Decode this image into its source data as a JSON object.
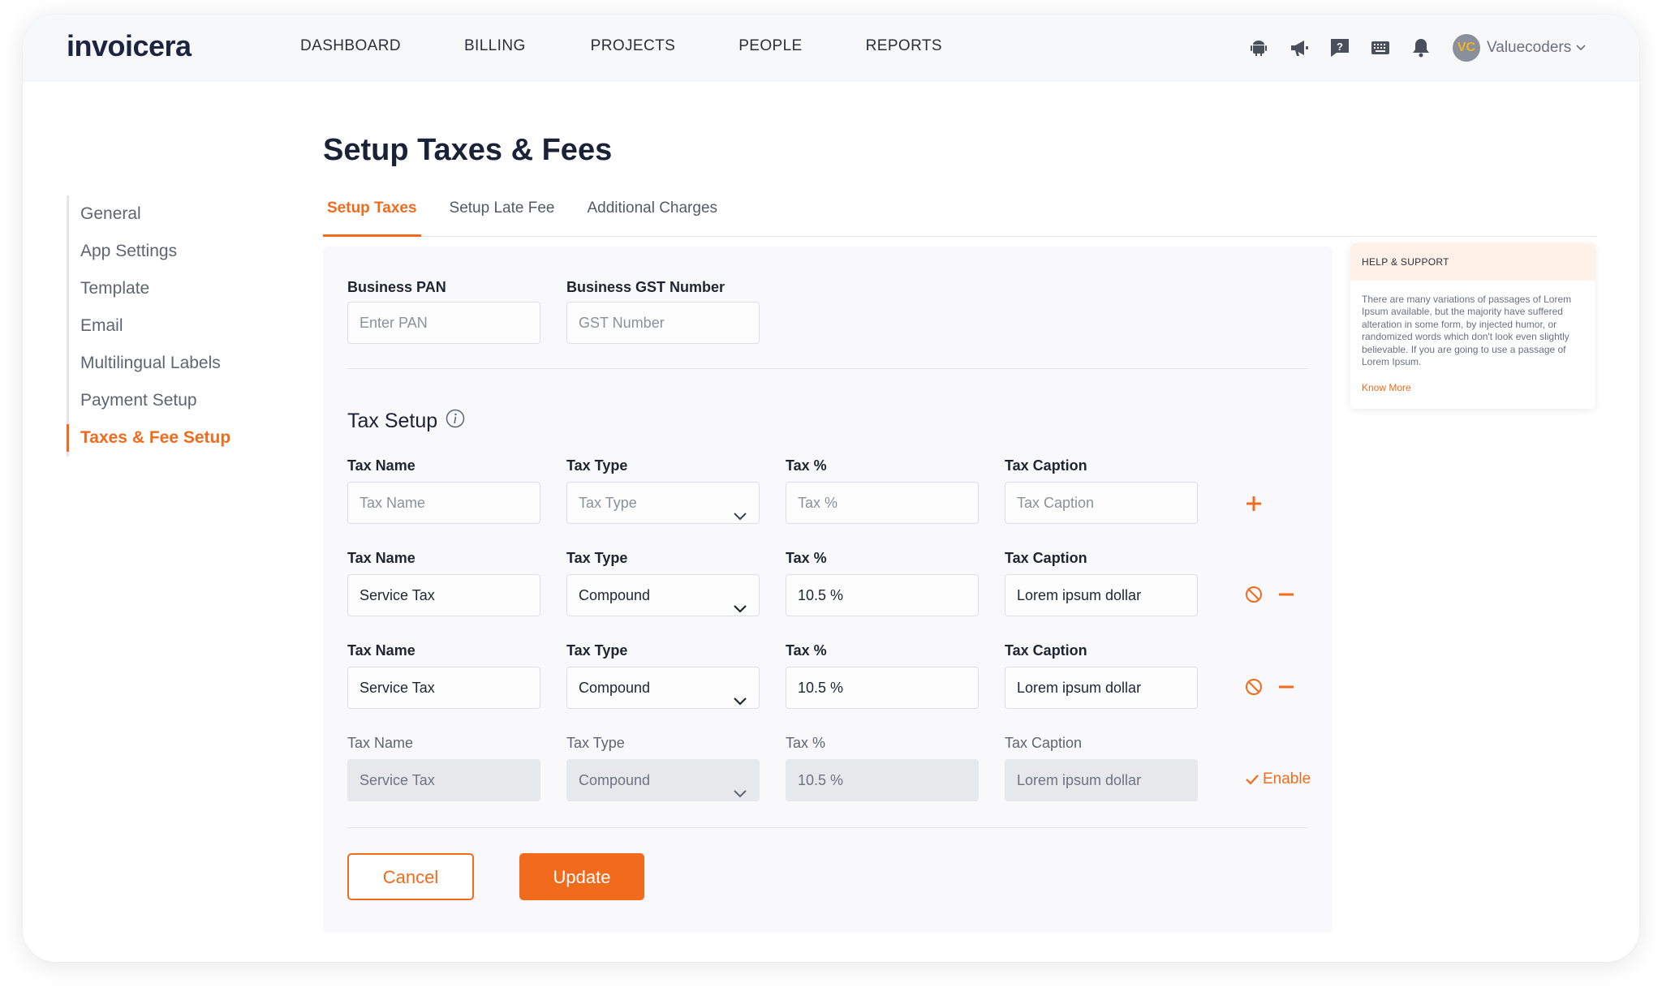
{
  "brand": {
    "name": "invoicera",
    "accent": "#f26b1d"
  },
  "nav": {
    "items": [
      "DASHBOARD",
      "BILLING",
      "PROJECTS",
      "PEOPLE",
      "REPORTS"
    ],
    "icons": [
      "android-icon",
      "megaphone-icon",
      "help-chat-icon",
      "keyboard-icon",
      "bell-icon"
    ],
    "user": {
      "initials": "VC",
      "name": "Valuecoders"
    }
  },
  "sidebar": {
    "items": [
      "General",
      "App Settings",
      "Template",
      "Email",
      "Multilingual Labels",
      "Payment Setup",
      "Taxes & Fee Setup"
    ],
    "active_index": 6
  },
  "page": {
    "title": "Setup Taxes & Fees",
    "tabs": [
      "Setup Taxes",
      "Setup Late Fee",
      "Additional Charges"
    ],
    "active_tab": 0
  },
  "business": {
    "pan_label": "Business PAN",
    "pan_placeholder": "Enter PAN",
    "gst_label": "Business GST Number",
    "gst_placeholder": "GST Number"
  },
  "tax_setup": {
    "title": "Tax Setup",
    "labels": {
      "name": "Tax Name",
      "type": "Tax Type",
      "percent": "Tax %",
      "caption": "Tax Caption"
    },
    "new_row": {
      "name": "Tax Name",
      "type": "Tax Type",
      "percent": "Tax %",
      "caption": "Tax Caption"
    },
    "rows": [
      {
        "name": "Service Tax",
        "type": "Compound",
        "percent": "10.5 %",
        "caption": "Lorem ipsum dollar"
      },
      {
        "name": "Service Tax",
        "type": "Compound",
        "percent": "10.5 %",
        "caption": "Lorem ipsum dollar"
      }
    ],
    "disabled_row": {
      "name": "Service Tax",
      "type": "Compound",
      "percent": "10.5 %",
      "caption": "Lorem ipsum dollar",
      "action": "Enable"
    }
  },
  "buttons": {
    "cancel": "Cancel",
    "update": "Update"
  },
  "help": {
    "title": "HELP & SUPPORT",
    "body": "There are many variations of passages of Lorem Ipsum available, but the majority have suffered alteration in some form, by injected humor, or randomized words which don't look even slightly believable. If you are going to use a passage of Lorem Ipsum.",
    "link": "Know More"
  }
}
